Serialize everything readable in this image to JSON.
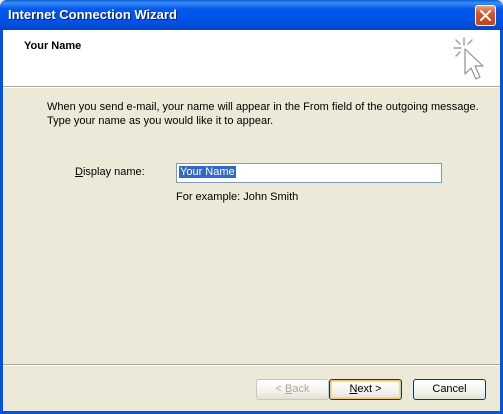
{
  "window": {
    "title": "Internet Connection Wizard",
    "close_icon": "close-icon"
  },
  "header": {
    "title": "Your Name",
    "icon": "wizard-cursor-icon"
  },
  "body": {
    "intro_line1": "When you send e-mail, your name will appear in the From field of the outgoing message.",
    "intro_line2": "Type your name as you would like it to appear.",
    "display_name_label_prefix": "D",
    "display_name_label_rest": "isplay name:",
    "display_name_value": "Your Name",
    "example_text": "For example: John Smith"
  },
  "footer": {
    "back_prefix": "< ",
    "back_ul": "B",
    "back_rest": "ack",
    "back_enabled": false,
    "next_ul": "N",
    "next_rest": "ext >",
    "cancel_label": "Cancel"
  },
  "colors": {
    "titlebar": "#0054e3",
    "face": "#ece9d8",
    "selection": "#316ac5"
  }
}
